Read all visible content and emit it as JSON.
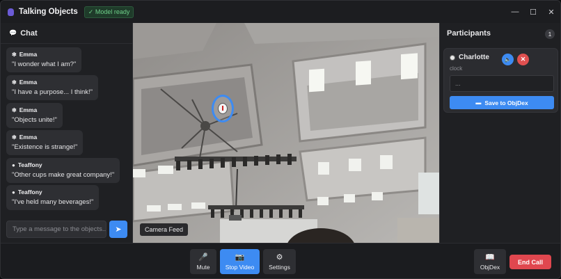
{
  "app": {
    "title": "Talking Objects",
    "status_badge": "✓ Model ready"
  },
  "window_controls": {
    "minimize": "—",
    "maximize": "☐",
    "close": "✕"
  },
  "chat": {
    "header": "Chat",
    "messages": [
      {
        "sender": "Emma",
        "icon": "sparkle-icon",
        "text": "\"I wonder what I am?\""
      },
      {
        "sender": "Emma",
        "icon": "sparkle-icon",
        "text": "\"I have a purpose... I think!\""
      },
      {
        "sender": "Emma",
        "icon": "sparkle-icon",
        "text": "\"Objects unite!\""
      },
      {
        "sender": "Emma",
        "icon": "sparkle-icon",
        "text": "\"Existence is strange!\""
      },
      {
        "sender": "Teaffony",
        "icon": "cup-icon",
        "text": "\"Other cups make great company!\""
      },
      {
        "sender": "Teaffony",
        "icon": "cup-icon",
        "text": "\"I've held many beverages!\""
      }
    ],
    "input_placeholder": "Type a message to the objects..."
  },
  "camera": {
    "label": "Camera Feed"
  },
  "participants": {
    "header": "Participants",
    "count": "1",
    "items": [
      {
        "name": "Charlotte",
        "type": "clock",
        "field_value": "...",
        "save_label": "Save to ObjDex"
      }
    ]
  },
  "controls": {
    "mute": "Mute",
    "stop_video": "Stop Video",
    "settings": "Settings",
    "objdex": "ObjDex",
    "end_call": "End Call"
  },
  "colors": {
    "accent": "#3d8bf2",
    "danger": "#e0474f",
    "badge_green": "#6fd08a"
  }
}
